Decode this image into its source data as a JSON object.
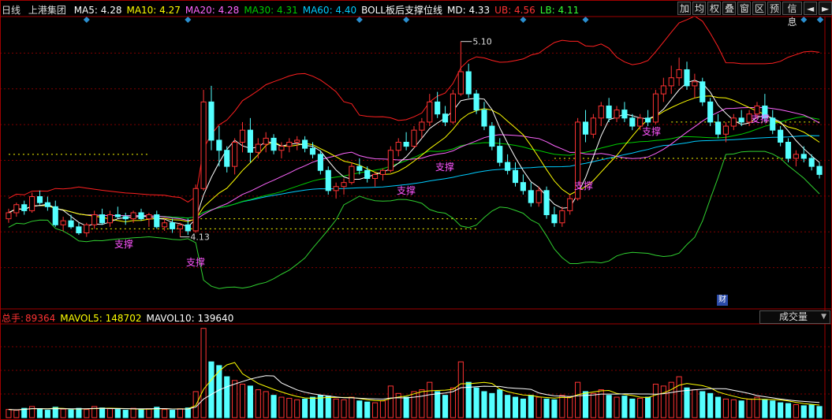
{
  "header": {
    "period": "日线",
    "stock": "上港集团",
    "indicators": [
      {
        "label": "MA5: 4.28",
        "color": "#ffffff"
      },
      {
        "label": "MA10: 4.27",
        "color": "#ffff00"
      },
      {
        "label": "MA20: 4.28",
        "color": "#ff66ff"
      },
      {
        "label": "MA30: 4.31",
        "color": "#00cc00"
      },
      {
        "label": "MA60: 4.40",
        "color": "#00ccff"
      },
      {
        "label": "BOLL板后支撑位线",
        "color": "#ffffff"
      },
      {
        "label": "MD: 4.33",
        "color": "#ffffff"
      },
      {
        "label": "UB: 4.56",
        "color": "#ff3333"
      },
      {
        "label": "LB: 4.11",
        "color": "#33ff33"
      }
    ]
  },
  "toolbar": [
    "加",
    "均",
    "权",
    "叠",
    "窗",
    "区",
    "预",
    "信息",
    "◄",
    "►"
  ],
  "volume_header": [
    {
      "label": "总手:",
      "color": "#ff3333"
    },
    {
      "label": "89364",
      "color": "#ff3333"
    },
    {
      "label": "MAVOL5: 148702",
      "color": "#ffff00"
    },
    {
      "label": "MAVOL10: 139640",
      "color": "#ffffff"
    }
  ],
  "volume_selector": "成交量",
  "badge": "财",
  "annotations": {
    "high_label": "5.10",
    "low_label": "4.13",
    "support_label": "支撑"
  },
  "colors": {
    "up": "#ff3333",
    "down": "#54ffff",
    "ub": "#ff2020",
    "lb": "#30d030",
    "ma5": "#ffffff",
    "ma10": "#ffff00",
    "ma20": "#ff66ff",
    "ma30": "#00cc00",
    "ma60": "#00ccff",
    "support": "#ffff00",
    "grid": "#800000"
  },
  "chart_data": {
    "type": "candlestick",
    "price_ylim": [
      3.8,
      5.22
    ],
    "candles": [
      [
        4.22,
        4.27,
        4.2,
        4.25
      ],
      [
        4.25,
        4.3,
        4.23,
        4.29
      ],
      [
        4.29,
        4.31,
        4.24,
        4.26
      ],
      [
        4.26,
        4.35,
        4.25,
        4.33
      ],
      [
        4.33,
        4.36,
        4.29,
        4.3
      ],
      [
        4.3,
        4.33,
        4.26,
        4.28
      ],
      [
        4.28,
        4.31,
        4.18,
        4.19
      ],
      [
        4.19,
        4.23,
        4.16,
        4.21
      ],
      [
        4.21,
        4.24,
        4.17,
        4.18
      ],
      [
        4.18,
        4.2,
        4.14,
        4.15
      ],
      [
        4.15,
        4.2,
        4.13,
        4.19
      ],
      [
        4.19,
        4.26,
        4.17,
        4.24
      ],
      [
        4.24,
        4.27,
        4.19,
        4.2
      ],
      [
        4.2,
        4.26,
        4.18,
        4.24
      ],
      [
        4.24,
        4.28,
        4.22,
        4.23
      ],
      [
        4.23,
        4.25,
        4.19,
        4.22
      ],
      [
        4.22,
        4.26,
        4.2,
        4.25
      ],
      [
        4.25,
        4.27,
        4.21,
        4.22
      ],
      [
        4.22,
        4.25,
        4.18,
        4.24
      ],
      [
        4.24,
        4.26,
        4.17,
        4.18
      ],
      [
        4.18,
        4.22,
        4.16,
        4.2
      ],
      [
        4.2,
        4.22,
        4.15,
        4.17
      ],
      [
        4.17,
        4.2,
        4.13,
        4.19
      ],
      [
        4.19,
        4.22,
        4.14,
        4.16
      ],
      [
        4.16,
        4.39,
        4.15,
        4.37
      ],
      [
        4.37,
        4.86,
        4.36,
        4.8
      ],
      [
        4.8,
        4.88,
        4.56,
        4.61
      ],
      [
        4.61,
        4.68,
        4.48,
        4.56
      ],
      [
        4.56,
        4.58,
        4.45,
        4.48
      ],
      [
        4.48,
        4.62,
        4.44,
        4.6
      ],
      [
        4.6,
        4.7,
        4.55,
        4.66
      ],
      [
        4.66,
        4.72,
        4.5,
        4.55
      ],
      [
        4.55,
        4.62,
        4.52,
        4.59
      ],
      [
        4.59,
        4.65,
        4.55,
        4.62
      ],
      [
        4.62,
        4.64,
        4.54,
        4.56
      ],
      [
        4.56,
        4.6,
        4.52,
        4.58
      ],
      [
        4.58,
        4.62,
        4.55,
        4.6
      ],
      [
        4.6,
        4.63,
        4.56,
        4.61
      ],
      [
        4.61,
        4.63,
        4.55,
        4.57
      ],
      [
        4.57,
        4.6,
        4.52,
        4.54
      ],
      [
        4.54,
        4.56,
        4.44,
        4.46
      ],
      [
        4.46,
        4.48,
        4.34,
        4.36
      ],
      [
        4.36,
        4.4,
        4.32,
        4.38
      ],
      [
        4.38,
        4.42,
        4.34,
        4.4
      ],
      [
        4.4,
        4.5,
        4.39,
        4.48
      ],
      [
        4.48,
        4.52,
        4.44,
        4.46
      ],
      [
        4.46,
        4.48,
        4.4,
        4.42
      ],
      [
        4.42,
        4.45,
        4.38,
        4.44
      ],
      [
        4.44,
        4.47,
        4.41,
        4.46
      ],
      [
        4.46,
        4.58,
        4.45,
        4.56
      ],
      [
        4.56,
        4.62,
        4.53,
        4.6
      ],
      [
        4.6,
        4.65,
        4.56,
        4.58
      ],
      [
        4.58,
        4.68,
        4.57,
        4.66
      ],
      [
        4.66,
        4.72,
        4.62,
        4.7
      ],
      [
        4.7,
        4.84,
        4.68,
        4.8
      ],
      [
        4.8,
        4.85,
        4.72,
        4.74
      ],
      [
        4.74,
        4.78,
        4.68,
        4.7
      ],
      [
        4.7,
        4.86,
        4.69,
        4.84
      ],
      [
        4.84,
        5.1,
        4.83,
        4.95
      ],
      [
        4.95,
        4.99,
        4.82,
        4.84
      ],
      [
        4.84,
        4.86,
        4.74,
        4.76
      ],
      [
        4.76,
        4.8,
        4.66,
        4.68
      ],
      [
        4.68,
        4.7,
        4.56,
        4.58
      ],
      [
        4.58,
        4.62,
        4.48,
        4.5
      ],
      [
        4.5,
        4.54,
        4.44,
        4.46
      ],
      [
        4.46,
        4.5,
        4.38,
        4.4
      ],
      [
        4.4,
        4.44,
        4.34,
        4.36
      ],
      [
        4.36,
        4.4,
        4.28,
        4.3
      ],
      [
        4.3,
        4.38,
        4.28,
        4.36
      ],
      [
        4.36,
        4.38,
        4.22,
        4.24
      ],
      [
        4.24,
        4.28,
        4.18,
        4.2
      ],
      [
        4.2,
        4.28,
        4.18,
        4.26
      ],
      [
        4.26,
        4.34,
        4.24,
        4.32
      ],
      [
        4.32,
        4.72,
        4.31,
        4.7
      ],
      [
        4.7,
        4.76,
        4.6,
        4.64
      ],
      [
        4.64,
        4.74,
        4.62,
        4.72
      ],
      [
        4.72,
        4.8,
        4.68,
        4.78
      ],
      [
        4.78,
        4.82,
        4.7,
        4.72
      ],
      [
        4.72,
        4.78,
        4.7,
        4.76
      ],
      [
        4.76,
        4.8,
        4.7,
        4.72
      ],
      [
        4.72,
        4.74,
        4.66,
        4.68
      ],
      [
        4.68,
        4.74,
        4.66,
        4.72
      ],
      [
        4.72,
        4.76,
        4.68,
        4.7
      ],
      [
        4.7,
        4.86,
        4.69,
        4.84
      ],
      [
        4.84,
        4.92,
        4.8,
        4.88
      ],
      [
        4.88,
        4.98,
        4.84,
        4.92
      ],
      [
        4.92,
        5.02,
        4.88,
        4.96
      ],
      [
        4.96,
        5.0,
        4.86,
        4.88
      ],
      [
        4.88,
        4.94,
        4.82,
        4.9
      ],
      [
        4.9,
        4.92,
        4.78,
        4.8
      ],
      [
        4.8,
        4.82,
        4.68,
        4.7
      ],
      [
        4.7,
        4.74,
        4.62,
        4.64
      ],
      [
        4.64,
        4.7,
        4.6,
        4.68
      ],
      [
        4.68,
        4.74,
        4.66,
        4.72
      ],
      [
        4.72,
        4.76,
        4.68,
        4.7
      ],
      [
        4.7,
        4.76,
        4.68,
        4.74
      ],
      [
        4.74,
        4.8,
        4.72,
        4.78
      ],
      [
        4.78,
        4.84,
        4.7,
        4.72
      ],
      [
        4.72,
        4.76,
        4.64,
        4.66
      ],
      [
        4.66,
        4.68,
        4.58,
        4.6
      ],
      [
        4.6,
        4.62,
        4.5,
        4.52
      ],
      [
        4.52,
        4.56,
        4.48,
        4.54
      ],
      [
        4.54,
        4.58,
        4.5,
        4.52
      ],
      [
        4.52,
        4.54,
        4.46,
        4.48
      ],
      [
        4.48,
        4.5,
        4.42,
        4.44
      ]
    ],
    "volume": [
      22,
      20,
      25,
      30,
      24,
      20,
      28,
      23,
      21,
      25,
      22,
      30,
      26,
      24,
      22,
      20,
      25,
      22,
      24,
      28,
      22,
      20,
      24,
      26,
      70,
      240,
      150,
      140,
      110,
      100,
      90,
      85,
      75,
      70,
      60,
      55,
      52,
      48,
      50,
      55,
      60,
      58,
      50,
      48,
      55,
      45,
      42,
      40,
      45,
      85,
      65,
      55,
      70,
      75,
      95,
      70,
      60,
      80,
      150,
      95,
      80,
      70,
      65,
      75,
      60,
      55,
      50,
      60,
      55,
      50,
      48,
      60,
      55,
      95,
      70,
      65,
      75,
      60,
      55,
      58,
      50,
      52,
      55,
      90,
      85,
      95,
      110,
      80,
      75,
      70,
      65,
      55,
      50,
      48,
      45,
      50,
      55,
      48,
      45,
      40,
      38,
      35,
      32,
      34,
      30
    ],
    "volume_ylim": [
      0,
      250
    ],
    "support_lines": [
      4.54,
      4.52,
      4.22,
      4.17,
      4.7,
      4.79,
      4.4
    ],
    "annotations": [
      "5.10",
      "4.13",
      "支撑"
    ]
  }
}
